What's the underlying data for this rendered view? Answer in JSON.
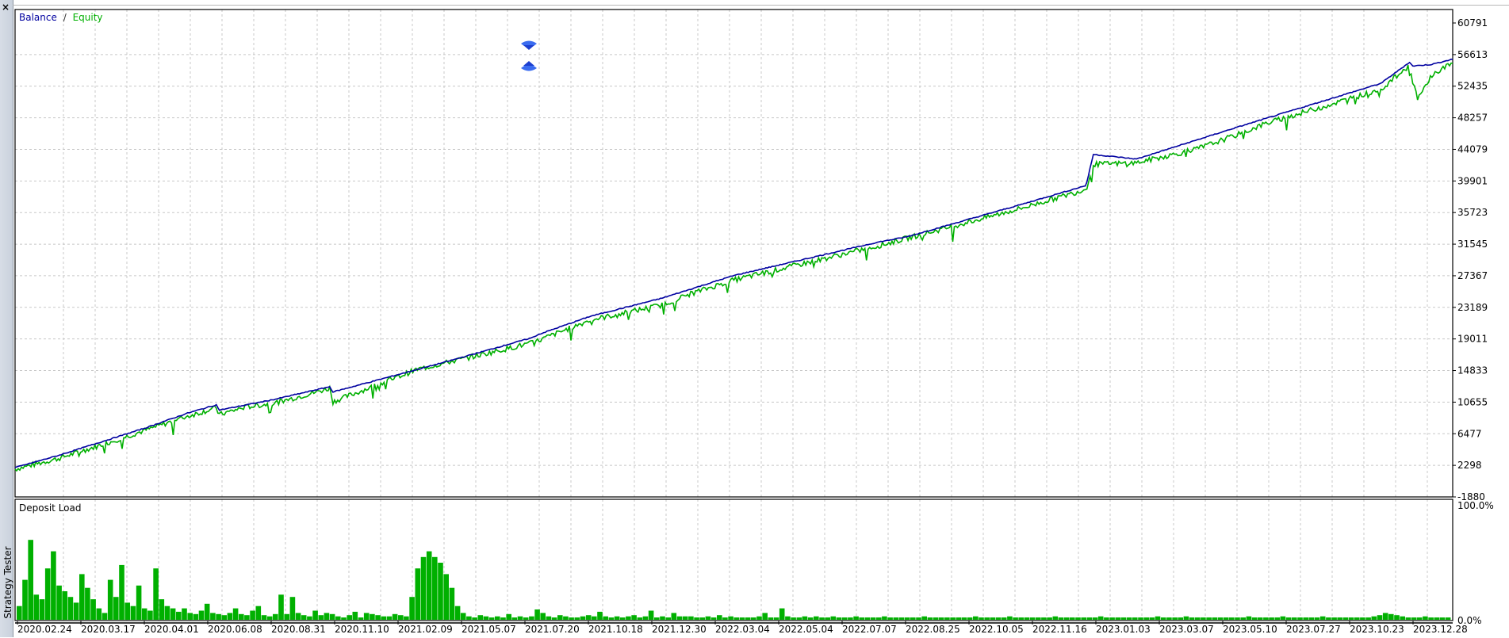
{
  "sidebar": {
    "close_glyph": "×",
    "tab_label": "Strategy Tester"
  },
  "colors": {
    "balance": "#0000a0",
    "equity": "#00b000",
    "grid": "#c8c8c8",
    "frame": "#000000",
    "signal": "#3a6cf0"
  },
  "chart_data": [
    {
      "type": "line",
      "legend": [
        {
          "label": "Balance",
          "color": "#0000a0"
        },
        {
          "label": "Equity",
          "color": "#00b000"
        }
      ],
      "legend_separator": "/",
      "y_ticks": [
        "60791",
        "56613",
        "52435",
        "48257",
        "44079",
        "39901",
        "35723",
        "31545",
        "27367",
        "23189",
        "19011",
        "14833",
        "10655",
        "6477",
        "2298",
        "-1880"
      ],
      "ylim": [
        -1880,
        60791
      ],
      "x_ticks": [
        "2020.02.24",
        "2020.03.17",
        "2020.04.01",
        "2020.06.08",
        "2020.08.31",
        "2020.11.10",
        "2021.02.09",
        "2021.05.07",
        "2021.07.20",
        "2021.10.18",
        "2021.12.30",
        "2022.03.04",
        "2022.05.04",
        "2022.07.07",
        "2022.08.25",
        "2022.10.05",
        "2022.11.16",
        "2023.01.03",
        "2023.03.07",
        "2023.05.10",
        "2023.07.27",
        "2023.10.23",
        "2023.12.28"
      ],
      "grid": true,
      "legend_position": "top-left",
      "series": [
        {
          "name": "Balance",
          "x": [
            0,
            3,
            6,
            9,
            12,
            14,
            14.2,
            18,
            21.9,
            22.1,
            30,
            36,
            36.4,
            40,
            45,
            50,
            60,
            62,
            70,
            74.5,
            75,
            78,
            85,
            95,
            97,
            97.2,
            98.5,
            100
          ],
          "values": [
            2000,
            3600,
            5400,
            7200,
            9200,
            10300,
            9600,
            11000,
            12700,
            12000,
            16000,
            19200,
            19600,
            22000,
            24400,
            27400,
            31800,
            32500,
            36800,
            39300,
            43400,
            42800,
            47000,
            52800,
            55600,
            55100,
            55300,
            56000
          ]
        },
        {
          "name": "Equity",
          "x": [
            0,
            3,
            6,
            9,
            12,
            14,
            14.2,
            16,
            18,
            20,
            21.9,
            22.1,
            28,
            36,
            40,
            45,
            47,
            50,
            60,
            70,
            74.5,
            75,
            78,
            82,
            85,
            87,
            95,
            97,
            97.2,
            97.6,
            98.5,
            100
          ],
          "values": [
            1800,
            3200,
            5000,
            6900,
            8800,
            9900,
            9000,
            10000,
            10500,
            11500,
            12500,
            10700,
            15000,
            18500,
            21500,
            23500,
            25000,
            26800,
            31300,
            36300,
            38800,
            42100,
            42300,
            44000,
            46000,
            47500,
            52000,
            55200,
            53000,
            50700,
            53800,
            55600
          ]
        }
      ]
    },
    {
      "type": "bar",
      "title": "Deposit Load",
      "y_ticks": [
        "100.0%",
        "0.0%"
      ],
      "ylim": [
        0,
        100
      ],
      "color": "#00b000",
      "values": [
        12,
        35,
        70,
        22,
        18,
        45,
        60,
        30,
        25,
        20,
        15,
        40,
        28,
        18,
        10,
        6,
        35,
        20,
        48,
        15,
        12,
        30,
        10,
        8,
        45,
        18,
        12,
        10,
        7,
        10,
        6,
        5,
        8,
        14,
        6,
        5,
        4,
        6,
        10,
        5,
        4,
        8,
        12,
        4,
        3,
        5,
        22,
        5,
        20,
        6,
        4,
        3,
        8,
        4,
        6,
        5,
        3,
        2,
        4,
        7,
        2,
        6,
        5,
        4,
        3,
        3,
        5,
        4,
        3,
        20,
        45,
        55,
        60,
        55,
        50,
        40,
        28,
        12,
        6,
        3,
        2,
        4,
        3,
        2,
        3,
        2,
        5,
        2,
        3,
        2,
        3,
        9,
        6,
        3,
        2,
        4,
        3,
        2,
        2,
        3,
        4,
        3,
        7,
        3,
        2,
        3,
        2,
        3,
        4,
        2,
        3,
        8,
        2,
        3,
        2,
        6,
        3,
        3,
        3,
        2,
        2,
        3,
        2,
        4,
        2,
        3,
        2,
        2,
        2,
        2,
        3,
        6,
        2,
        2,
        10,
        3,
        2,
        2,
        3,
        2,
        3,
        2,
        2,
        3,
        2,
        2,
        2,
        3,
        2,
        2,
        2,
        2,
        3,
        2,
        2,
        2,
        2,
        2,
        2,
        3,
        2,
        2,
        2,
        2,
        2,
        2,
        2,
        2,
        3,
        2,
        2,
        2,
        2,
        2,
        3,
        2,
        2,
        2,
        2,
        2,
        2,
        2,
        3,
        2,
        2,
        2,
        2,
        2,
        2,
        2,
        3,
        2,
        2,
        2,
        2,
        2,
        2,
        2,
        2,
        2,
        3,
        2,
        2,
        2,
        2,
        3,
        2,
        2,
        2,
        2,
        2,
        2,
        2,
        2,
        2,
        2,
        3,
        2,
        2,
        2,
        2,
        2,
        3,
        2,
        2,
        2,
        2,
        2,
        2,
        3,
        2,
        2,
        2,
        2,
        2,
        2,
        2,
        2,
        3,
        4,
        6,
        5,
        4,
        3,
        2,
        2,
        2,
        3,
        2,
        2,
        2,
        2
      ]
    }
  ]
}
